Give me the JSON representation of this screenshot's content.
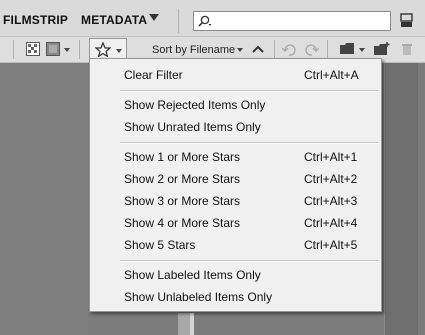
{
  "tabs": {
    "filmstrip": "FILMSTRIP",
    "metadata": "METADATA"
  },
  "search": {
    "value": ""
  },
  "toolbar": {
    "sort_label": "Sort by Filename"
  },
  "menu": {
    "items": [
      {
        "label": "Clear Filter",
        "shortcut": "Ctrl+Alt+A"
      },
      {
        "label": "Show Rejected Items Only",
        "shortcut": ""
      },
      {
        "label": "Show Unrated Items Only",
        "shortcut": ""
      },
      {
        "label": "Show 1 or More Stars",
        "shortcut": "Ctrl+Alt+1"
      },
      {
        "label": "Show 2 or More Stars",
        "shortcut": "Ctrl+Alt+2"
      },
      {
        "label": "Show 3 or More Stars",
        "shortcut": "Ctrl+Alt+3"
      },
      {
        "label": "Show 4 or More Stars",
        "shortcut": "Ctrl+Alt+4"
      },
      {
        "label": "Show 5 Stars",
        "shortcut": "Ctrl+Alt+5"
      },
      {
        "label": "Show Labeled Items Only",
        "shortcut": ""
      },
      {
        "label": "Show Unlabeled Items Only",
        "shortcut": ""
      }
    ]
  },
  "icons": {
    "search": "search-icon",
    "window": "window-mode-icon",
    "thumb_quality": "thumbnail-quality-icon",
    "view_options": "view-options-icon",
    "filter": "star-icon",
    "sort_direction": "sort-ascending-icon",
    "rotate_left": "rotate-left-icon",
    "rotate_right": "rotate-right-icon",
    "open_recent": "folder-icon",
    "new_folder": "new-folder-icon",
    "delete": "trash-icon"
  }
}
